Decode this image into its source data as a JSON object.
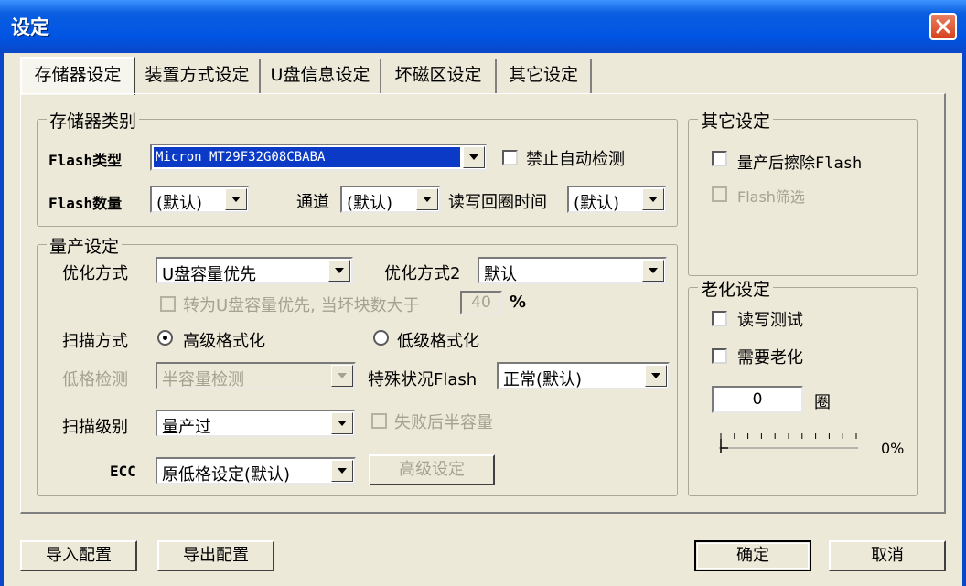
{
  "window": {
    "title": "设定"
  },
  "tabs": [
    "存储器设定",
    "装置方式设定",
    "U盘信息设定",
    "坏磁区设定",
    "其它设定"
  ],
  "memory_type": {
    "legend": "存储器类别",
    "flash_type_label": "Flash类型",
    "flash_type_value": "Micron MT29F32G08CBABA",
    "disable_auto_detect_label": "禁止自动检测",
    "flash_count_label": "Flash数量",
    "flash_count_value": "(默认)",
    "channel_label": "通道",
    "channel_value": "(默认)",
    "rw_loop_label": "读写回圈时间",
    "rw_loop_value": "(默认)"
  },
  "production": {
    "legend": "量产设定",
    "opt_method_label": "优化方式",
    "opt_method_value": "U盘容量优先",
    "opt_method2_label": "优化方式2",
    "opt_method2_value": "默认",
    "switch_label": "转为U盘容量优先, 当坏块数大于",
    "switch_value": "40",
    "switch_unit": "%",
    "scan_method_label": "扫描方式",
    "scan_high_label": "高级格式化",
    "scan_low_label": "低级格式化",
    "low_check_label": "低格检测",
    "low_check_value": "半容量检测",
    "special_flash_label": "特殊状况Flash",
    "special_flash_value": "正常(默认)",
    "scan_level_label": "扫描级别",
    "scan_level_value": "量产过",
    "half_capacity_label": "失败后半容量",
    "ecc_label": "ECC",
    "ecc_value": "原低格设定(默认)",
    "advanced_button": "高级设定"
  },
  "other": {
    "legend": "其它设定",
    "erase_flash_label": "量产后擦除Flash",
    "flash_filter_label": "Flash筛选"
  },
  "aging": {
    "legend": "老化设定",
    "rw_test_label": "读写测试",
    "need_aging_label": "需要老化",
    "cycles_value": "0",
    "cycles_unit": "圈",
    "progress_text": "0%",
    "progress": 0
  },
  "footer": {
    "import_button": "导入配置",
    "export_button": "导出配置",
    "ok_button": "确定",
    "cancel_button": "取消"
  }
}
